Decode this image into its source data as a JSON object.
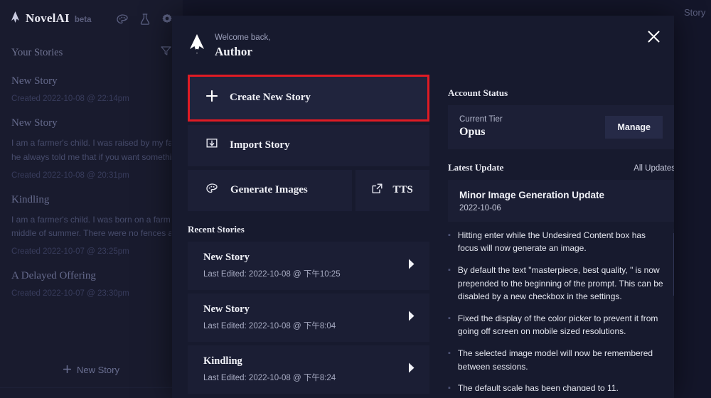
{
  "background": {
    "brand": {
      "name": "NovelAI",
      "beta": "beta"
    },
    "top_icons": [
      {
        "name": "palette-icon"
      },
      {
        "name": "flask-icon"
      },
      {
        "name": "gear-icon"
      }
    ],
    "sidebar": {
      "header": "Your Stories",
      "filter_icon": "filter-icon",
      "new_story_label": "New Story",
      "stories": [
        {
          "title": "New Story",
          "excerpt": [],
          "created": "Created 2022-10-08 @ 22:14pm"
        },
        {
          "title": "New Story",
          "excerpt": [
            "I am a farmer's child. I was raised by my father,",
            "he always told me that if you want something c"
          ],
          "created": "Created 2022-10-08 @ 20:31pm"
        },
        {
          "title": "Kindling",
          "excerpt": [
            "I am a farmer's child. I was born on a farm in th",
            "middle of summer. There were no fences aroun"
          ],
          "created": "Created 2022-10-07 @ 23:25pm"
        },
        {
          "title": "A Delayed Offering",
          "excerpt": [],
          "created": "Created 2022-10-07 @ 23:30pm"
        }
      ]
    },
    "main_tab_label": "Story"
  },
  "modal": {
    "close_icon": "close-icon",
    "welcome": {
      "greeting": "Welcome back,",
      "user": "Author"
    },
    "actions": [
      {
        "label": "Create New Story",
        "icon": "plus-icon",
        "highlighted": true
      },
      {
        "label": "Import Story",
        "icon": "import-icon",
        "highlighted": false
      },
      {
        "label": "Generate Images",
        "icon": "palette-icon",
        "highlighted": false
      },
      {
        "label": "TTS",
        "icon": "external-link-icon",
        "highlighted": false
      }
    ],
    "recent": {
      "heading": "Recent Stories",
      "items": [
        {
          "title": "New Story",
          "subtitle": "Last Edited: 2022-10-08 @ 下午10:25",
          "arrow": "chevron-right-icon"
        },
        {
          "title": "New Story",
          "subtitle": "Last Edited: 2022-10-08 @ 下午8:04",
          "arrow": "chevron-right-icon"
        },
        {
          "title": "Kindling",
          "subtitle": "Last Edited: 2022-10-08 @ 下午8:24",
          "arrow": "chevron-right-icon"
        }
      ]
    },
    "account": {
      "heading": "Account Status",
      "tier_label": "Current Tier",
      "tier_value": "Opus",
      "manage_label": "Manage"
    },
    "update": {
      "heading": "Latest Update",
      "all_updates_label": "All Updates",
      "title": "Minor Image Generation Update",
      "date": "2022-10-06",
      "notes": [
        "Hitting enter while the Undesired Content box has focus will now generate an image.",
        "By default the text \"masterpiece, best quality, \" is now prepended to the beginning of the prompt. This can be disabled by a new checkbox in the settings.",
        "Fixed the display of the color picker to prevent it from going off screen on mobile sized resolutions.",
        "The selected image model will now be remembered between sessions.",
        "The default scale has been changed to 11."
      ]
    }
  },
  "colors": {
    "highlight_border": "#e01b24",
    "modal_bg": "#171a2e",
    "tile_bg": "#1c1f36",
    "accent_button": "#262a47"
  }
}
